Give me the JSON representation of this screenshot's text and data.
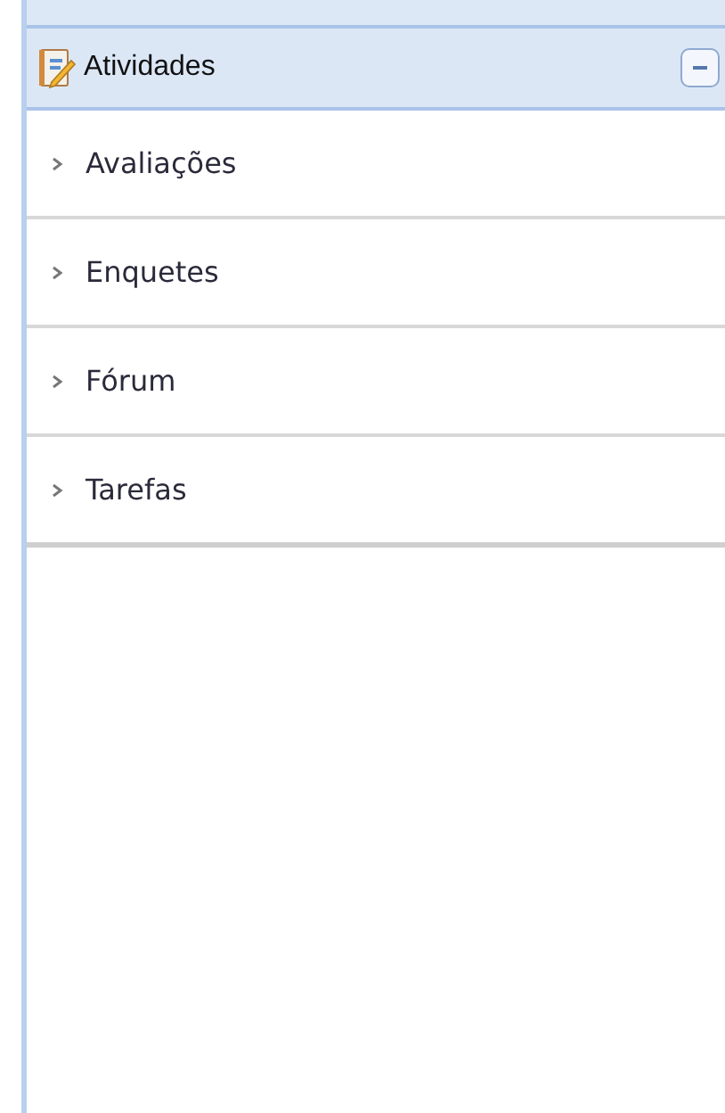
{
  "panel": {
    "title": "Atividades",
    "expanded": true,
    "items": [
      {
        "label": "Avaliações"
      },
      {
        "label": "Enquetes"
      },
      {
        "label": "Fórum"
      },
      {
        "label": "Tarefas"
      }
    ]
  }
}
